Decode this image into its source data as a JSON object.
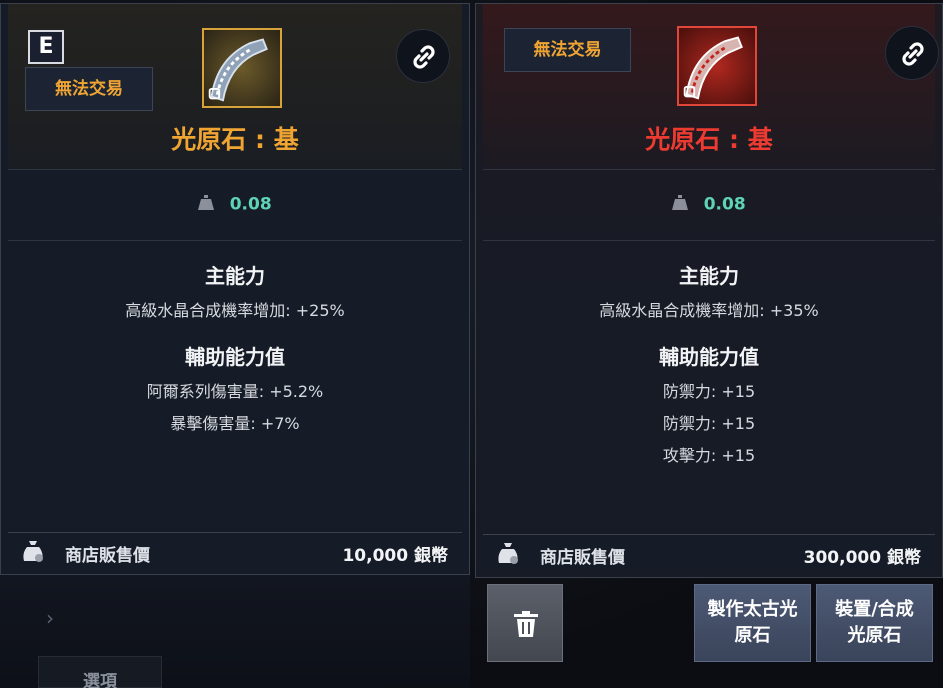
{
  "background": {
    "tab_label": "選項",
    "chevron": "›"
  },
  "left_card": {
    "grade": "E",
    "trade_status": "無法交易",
    "item_icon": "light-stone-gold-icon",
    "item_name": "光原石 : 基",
    "name_color": "#f0a532",
    "weight": "0.08",
    "main_title": "主能力",
    "main_stats": [
      "高級水晶合成機率增加: +25%"
    ],
    "sub_title": "輔助能力值",
    "sub_stats": [
      "阿爾系列傷害量: +5.2%",
      "暴擊傷害量: +7%"
    ],
    "price_label": "商店販售價",
    "price_value": "10,000 銀幣"
  },
  "right_card": {
    "trade_status": "無法交易",
    "item_icon": "light-stone-red-icon",
    "item_name": "光原石 : 基",
    "name_color": "#ee3b32",
    "weight": "0.08",
    "main_title": "主能力",
    "main_stats": [
      "高級水晶合成機率增加: +35%"
    ],
    "sub_title": "輔助能力值",
    "sub_stats": [
      "防禦力: +15",
      "防禦力: +15",
      "攻擊力: +15"
    ],
    "price_label": "商店販售價",
    "price_value": "300,000 銀幣"
  },
  "actions": {
    "craft_label_1": "製作太古光",
    "craft_label_2": "原石",
    "equip_label_1": "裝置/合成",
    "equip_label_2": "光原石"
  },
  "colors": {
    "weight_value": "#5fd3b5",
    "trade_tag": "#f0a532"
  }
}
